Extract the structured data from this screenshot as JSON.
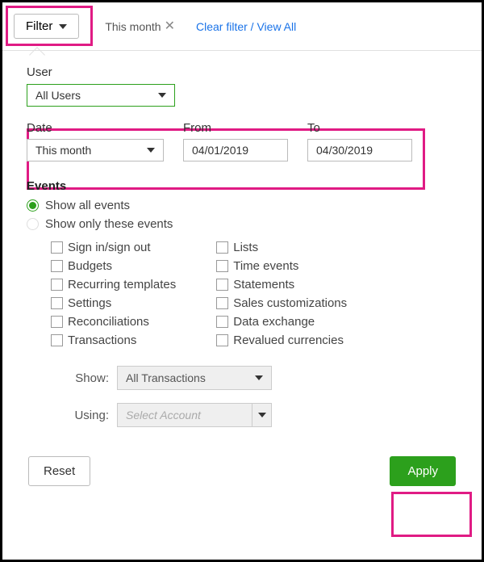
{
  "topbar": {
    "filter_label": "Filter",
    "chip": "This month",
    "clear_link": "Clear filter / View All"
  },
  "user": {
    "label": "User",
    "value": "All Users"
  },
  "date": {
    "label": "Date",
    "range_value": "This month",
    "from_label": "From",
    "from_value": "04/01/2019",
    "to_label": "To",
    "to_value": "04/30/2019"
  },
  "events": {
    "title": "Events",
    "radio_all": "Show all events",
    "radio_only": "Show only these events",
    "left": [
      "Sign in/sign out",
      "Budgets",
      "Recurring templates",
      "Settings",
      "Reconciliations",
      "Transactions"
    ],
    "right": [
      "Lists",
      "Time events",
      "Statements",
      "Sales customizations",
      "Data exchange",
      "Revalued currencies"
    ]
  },
  "sub": {
    "show_label": "Show:",
    "show_value": "All Transactions",
    "using_label": "Using:",
    "using_placeholder": "Select Account"
  },
  "footer": {
    "reset": "Reset",
    "apply": "Apply"
  }
}
